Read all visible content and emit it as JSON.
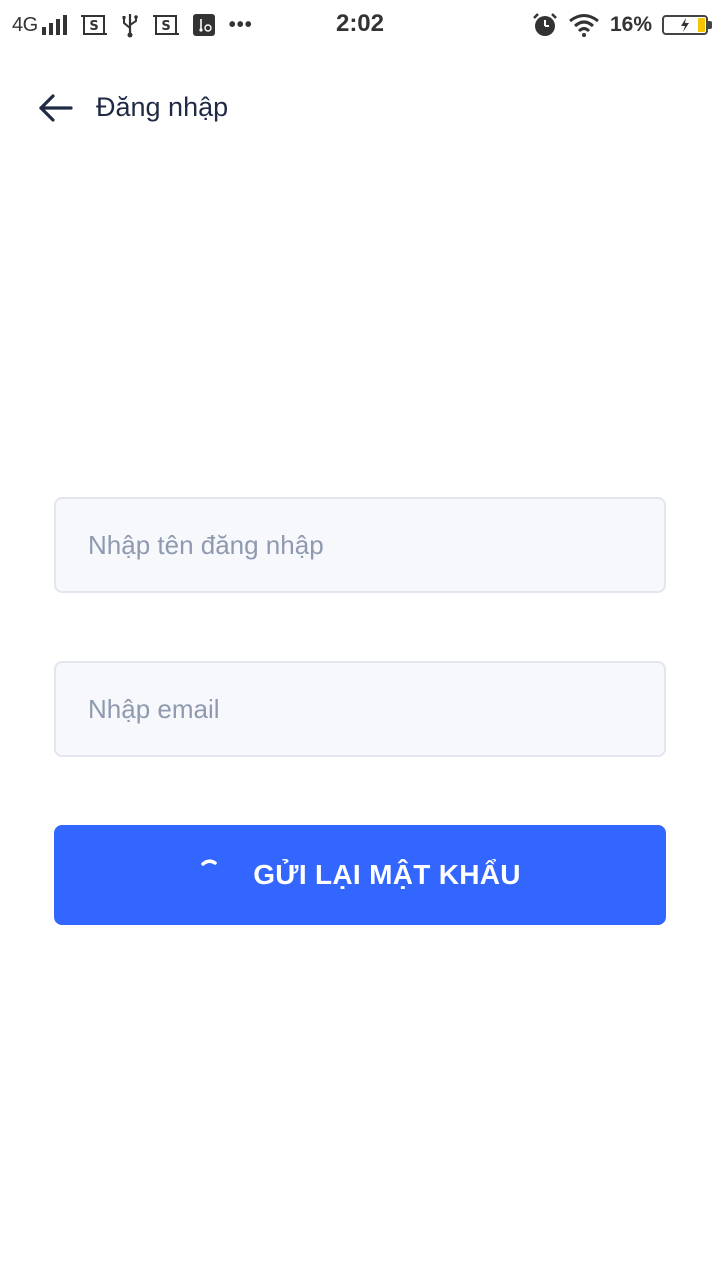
{
  "status_bar": {
    "network": "4G",
    "time": "2:02",
    "battery_percent": "16%",
    "battery_level": 0.16,
    "more": "•••",
    "icons": [
      "signal-icon",
      "screenshot-icon",
      "usb-icon",
      "screenshot-icon",
      "usb-debug-icon",
      "more-icon",
      "alarm-icon",
      "wifi-icon",
      "battery-charging-icon"
    ]
  },
  "header": {
    "back_icon": "arrow-left-icon",
    "title": "Đăng nhập"
  },
  "form": {
    "username": {
      "placeholder": "Nhập tên đăng nhập",
      "value": ""
    },
    "email": {
      "placeholder": "Nhập email",
      "value": ""
    },
    "submit": {
      "label": "GỬI LẠI MẬT KHẨU",
      "loading": true,
      "loading_icon": "spinner-icon"
    }
  },
  "colors": {
    "primary": "#3366ff",
    "field_background": "#f7f8fc",
    "field_border": "#e3e6ee",
    "placeholder": "#8f9ab0",
    "text": "#1f2a44",
    "battery_fill": "#f5c400"
  }
}
